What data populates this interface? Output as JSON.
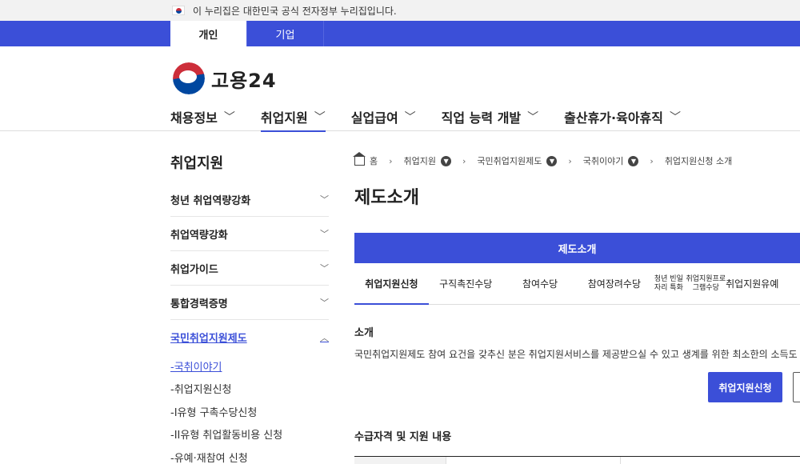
{
  "gov_notice": "이 누리집은 대한민국 공식 전자정부 누리집입니다.",
  "user_tabs": [
    "개인",
    "기업"
  ],
  "logo_text": "고용24",
  "gnb": [
    "채용정보",
    "취업지원",
    "실업급여",
    "직업 능력 개발",
    "출산휴가·육아휴직"
  ],
  "sidebar": {
    "title": "취업지원",
    "items": [
      "청년 취업역량강화",
      "취업역량강화",
      "취업가이드",
      "통합경력증명",
      "국민취업지원제도"
    ],
    "subitems": [
      "-국취이야기",
      "-취업지원신청",
      "-I유형 구촉수당신청",
      "-II유형 취업활동비용 신청",
      "-유예·재참여 신청"
    ]
  },
  "breadcrumb": [
    "홈",
    "취업지원",
    "국민취업지원제도",
    "국취이야기",
    "취업지원신청 소개"
  ],
  "page_title": "제도소개",
  "blue_tab": "제도소개",
  "sub_tabs": [
    "취업지원신청",
    "구직촉진수당",
    "참여수당",
    "참여장려수당",
    "청년 빈일자리 특화",
    "취업지원프로그램수당",
    "취업지원유예"
  ],
  "intro": {
    "label": "소개",
    "desc": "국민취업지원제도 참여 요건을 갖추신 분은 취업지원서비스를 제공받으실 수 있고 생계를 위한 최소한의 소득도"
  },
  "apply_button": "취업지원신청",
  "section2_title": "수급자격 및 지원 내용",
  "colors": {
    "primary": "#3b4fd8"
  }
}
